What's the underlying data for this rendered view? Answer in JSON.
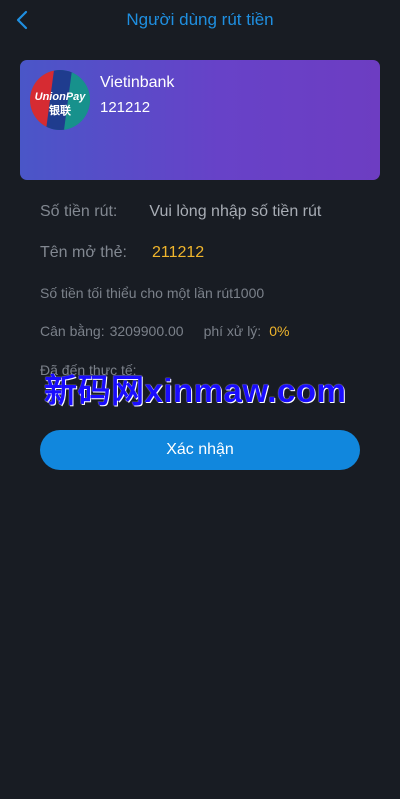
{
  "header": {
    "title": "Người dùng rút tiền",
    "back_icon": "chevron-left-icon"
  },
  "card": {
    "logo_icon": "unionpay-logo",
    "logo_text": "UnionPay",
    "logo_subtext": "银联",
    "bank_name": "Vietinbank",
    "card_number": "121212"
  },
  "form": {
    "amount_label": "Số tiền rút:",
    "amount_placeholder": "Vui lòng nhập số tiền rút",
    "holder_label": "Tên mở thẻ:",
    "holder_value": "211212",
    "min_amount_text": "Số tiền tối thiểu cho một lần rút1000",
    "balance_label": "Cân bằng:",
    "balance_value": "3209900.00",
    "fee_label": "phí xử lý:",
    "fee_value": "0%",
    "actual_label": "Đã đến thực tế:"
  },
  "watermark": "新码网xinmaw.com",
  "confirm_label": "Xác nhận",
  "colors": {
    "background": "#181c23",
    "accent": "#1187dd",
    "highlight": "#f0b52c"
  }
}
